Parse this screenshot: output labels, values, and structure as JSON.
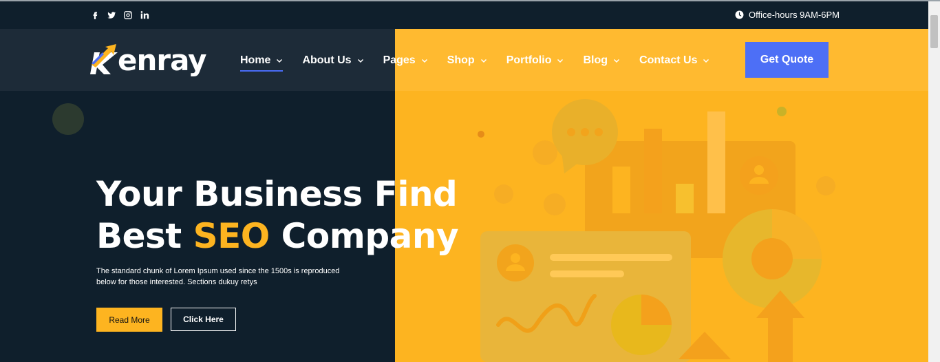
{
  "topbar": {
    "social": [
      {
        "icon": "facebook-icon",
        "glyph": "f"
      },
      {
        "icon": "twitter-icon",
        "glyph": "t"
      },
      {
        "icon": "instagram-icon",
        "glyph": "i"
      },
      {
        "icon": "linkedin-icon",
        "glyph": "in"
      }
    ],
    "hours_icon": "clock-icon",
    "hours_text": "Office-hours 9AM-6PM"
  },
  "brand": {
    "logo_text": "enray",
    "logo_icon": "arrow-k-icon"
  },
  "nav": {
    "items": [
      {
        "label": "Home",
        "active": true
      },
      {
        "label": "About Us",
        "active": false
      },
      {
        "label": "Pages",
        "active": false
      },
      {
        "label": "Shop",
        "active": false
      },
      {
        "label": "Portfolio",
        "active": false
      },
      {
        "label": "Blog",
        "active": false
      },
      {
        "label": "Contact Us",
        "active": false
      }
    ],
    "cta_label": "Get Quote"
  },
  "hero": {
    "title_line1": "Your Business Find",
    "title_line2_pre": "Best ",
    "title_line2_highlight": "SEO",
    "title_line2_post": " Company",
    "description": "The standard chunk of Lorem Ipsum used since the 1500s is reproduced below for those interested. Sections dukuy retys",
    "primary_button": "Read More",
    "secondary_button": "Click Here"
  },
  "colors": {
    "dark": "#0f1f2c",
    "accent": "#fdb420",
    "button_blue": "#4d6ff6"
  }
}
